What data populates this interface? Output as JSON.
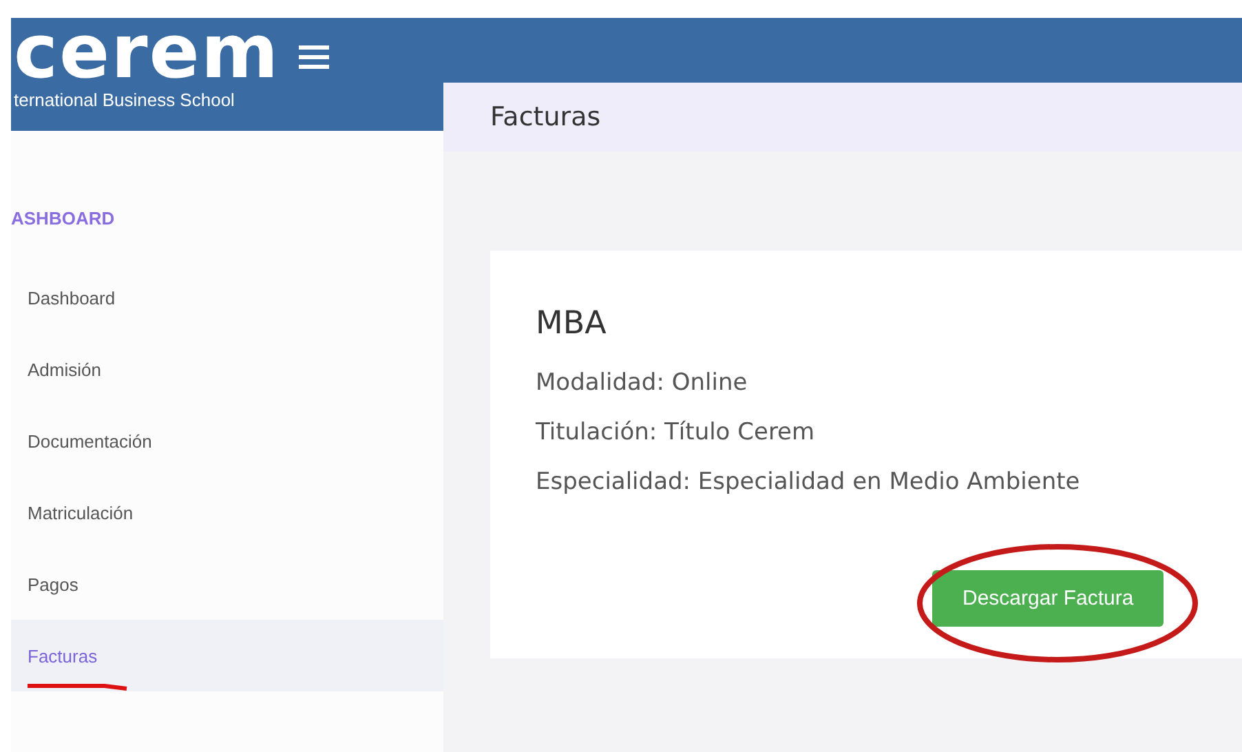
{
  "header": {
    "logo_text": "cerem",
    "logo_subtitle": "ternational Business School"
  },
  "page_title": "Facturas",
  "sidebar": {
    "heading": "ASHBOARD",
    "items": [
      {
        "label": "Dashboard",
        "selected": false,
        "underlined": false
      },
      {
        "label": "Admisión",
        "selected": false,
        "underlined": false
      },
      {
        "label": "Documentación",
        "selected": false,
        "underlined": false
      },
      {
        "label": "Matriculación",
        "selected": false,
        "underlined": false
      },
      {
        "label": "Pagos",
        "selected": false,
        "underlined": false
      },
      {
        "label": "Facturas",
        "selected": true,
        "underlined": true
      }
    ]
  },
  "card": {
    "title": "MBA",
    "lines": [
      "Modalidad: Online",
      "Titulación: Título Cerem",
      "Especialidad: Especialidad en Medio Ambiente"
    ],
    "button": {
      "label": "Descargar Factura",
      "circled": true
    }
  }
}
